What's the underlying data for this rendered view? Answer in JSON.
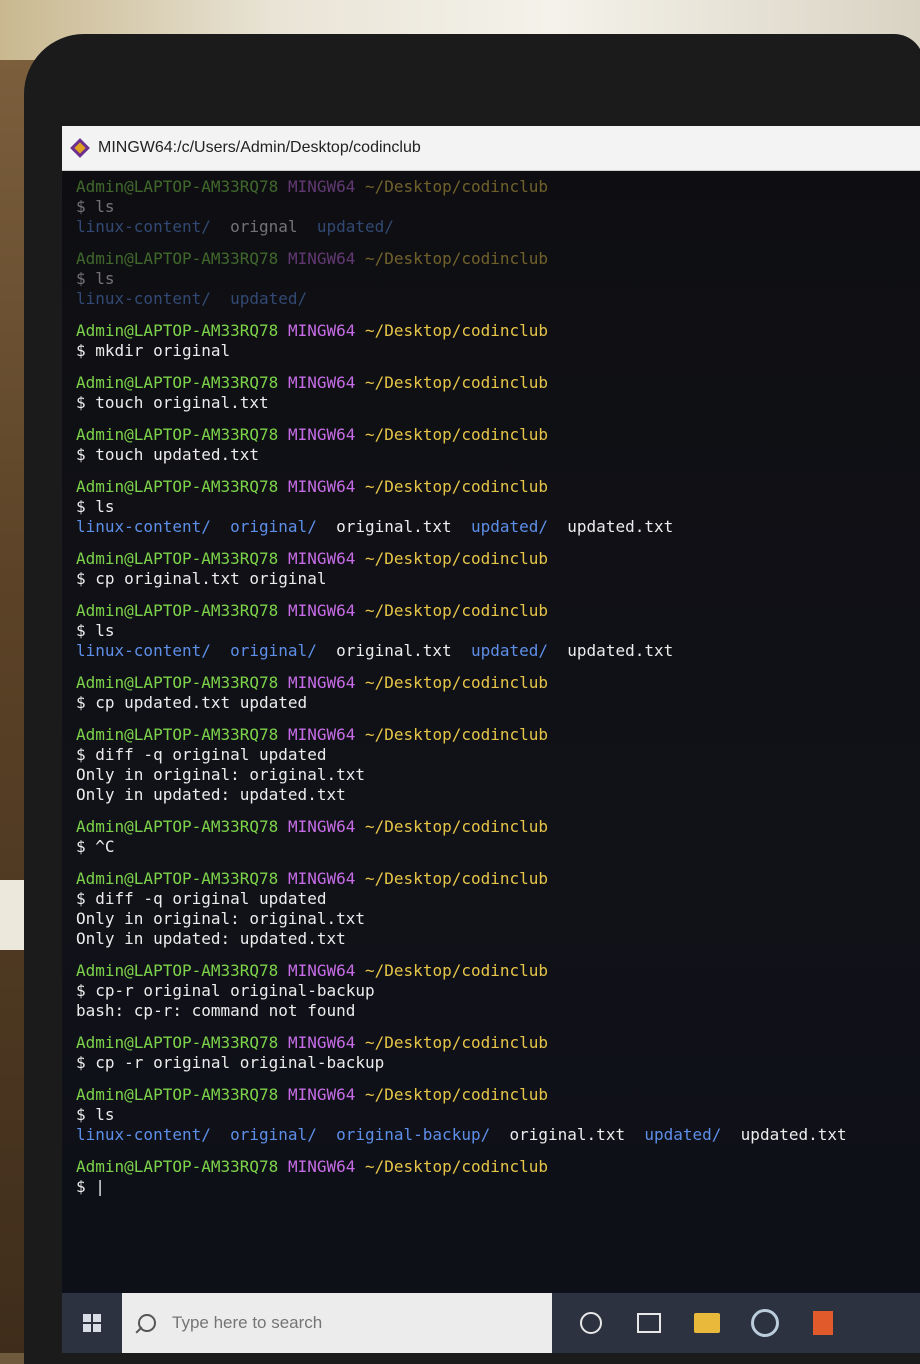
{
  "window": {
    "title": "MINGW64:/c/Users/Admin/Desktop/codinclub"
  },
  "prompt": {
    "user": "Admin@LAPTOP-AM33RQ78",
    "host": "MINGW64",
    "path": "~/Desktop/codinclub"
  },
  "terminal": {
    "blocks": [
      {
        "command": "$ ls",
        "output": [
          {
            "segments": [
              [
                "dir",
                "linux-content/"
              ],
              [
                "out",
                "  orignal  "
              ],
              [
                "dir",
                "updated/"
              ]
            ]
          }
        ]
      },
      {
        "command": "$ ls",
        "output": [
          {
            "segments": [
              [
                "dir",
                "linux-content/"
              ],
              [
                "out",
                "  "
              ],
              [
                "dir",
                "updated/"
              ]
            ]
          }
        ]
      },
      {
        "command": "$ mkdir original",
        "output": []
      },
      {
        "command": "$ touch original.txt",
        "output": []
      },
      {
        "command": "$ touch updated.txt",
        "output": []
      },
      {
        "command": "$ ls",
        "output": [
          {
            "segments": [
              [
                "dir",
                "linux-content/"
              ],
              [
                "out",
                "  "
              ],
              [
                "dir",
                "original/"
              ],
              [
                "out",
                "  original.txt  "
              ],
              [
                "dir",
                "updated/"
              ],
              [
                "out",
                "  updated.txt"
              ]
            ]
          }
        ]
      },
      {
        "command": "$ cp original.txt original",
        "output": []
      },
      {
        "command": "$ ls",
        "output": [
          {
            "segments": [
              [
                "dir",
                "linux-content/"
              ],
              [
                "out",
                "  "
              ],
              [
                "dir",
                "original/"
              ],
              [
                "out",
                "  original.txt  "
              ],
              [
                "dir",
                "updated/"
              ],
              [
                "out",
                "  updated.txt"
              ]
            ]
          }
        ]
      },
      {
        "command": "$ cp updated.txt updated",
        "output": []
      },
      {
        "command": "$ diff -q original updated",
        "output": [
          {
            "segments": [
              [
                "out",
                "Only in original: original.txt"
              ]
            ]
          },
          {
            "segments": [
              [
                "out",
                "Only in updated: updated.txt"
              ]
            ]
          }
        ]
      },
      {
        "command": "$ ^C",
        "output": []
      },
      {
        "command": "$ diff -q original updated",
        "output": [
          {
            "segments": [
              [
                "out",
                "Only in original: original.txt"
              ]
            ]
          },
          {
            "segments": [
              [
                "out",
                "Only in updated: updated.txt"
              ]
            ]
          }
        ]
      },
      {
        "command": "$ cp-r original original-backup",
        "output": [
          {
            "segments": [
              [
                "out",
                "bash: cp-r: command not found"
              ]
            ]
          }
        ]
      },
      {
        "command": "$ cp -r original original-backup",
        "output": []
      },
      {
        "command": "$ ls",
        "output": [
          {
            "segments": [
              [
                "dir",
                "linux-content/"
              ],
              [
                "out",
                "  "
              ],
              [
                "dir",
                "original/"
              ],
              [
                "out",
                "  "
              ],
              [
                "dir",
                "original-backup/"
              ],
              [
                "out",
                "  original.txt  "
              ],
              [
                "dir",
                "updated/"
              ],
              [
                "out",
                "  updated.txt"
              ]
            ]
          }
        ]
      },
      {
        "command": "$ |",
        "output": []
      }
    ]
  },
  "taskbar": {
    "search_placeholder": "Type here to search"
  },
  "colors": {
    "user": "#7cd34a",
    "host": "#c66ce6",
    "path": "#e6c548",
    "directory": "#5d8fe8"
  }
}
